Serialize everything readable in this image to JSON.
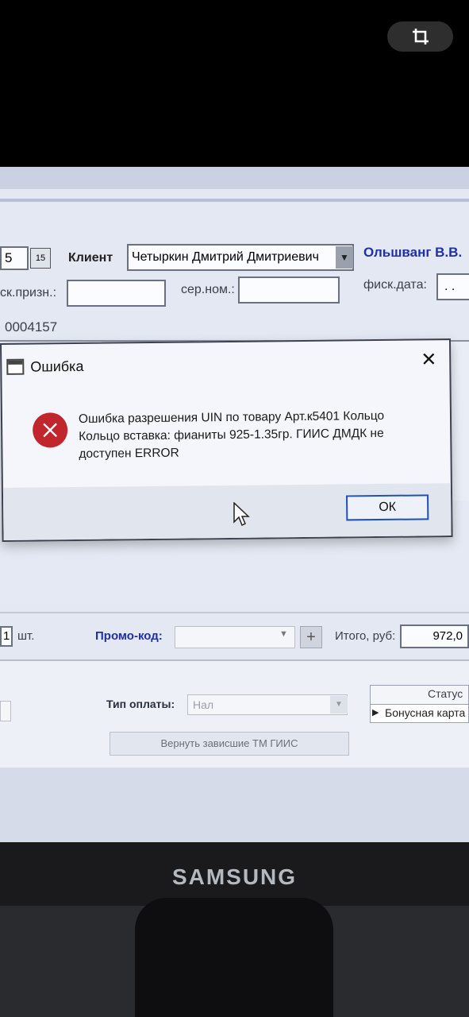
{
  "crop_button": {
    "icon": "crop-icon"
  },
  "form": {
    "date_fragment": "5",
    "calendar_label": "15",
    "client_label": "Клиент",
    "client_value": "Четыркин Дмитрий Дмитриевич",
    "manager_name": "Ольшванг В.В.",
    "fisc_sign_label": "ск.призн.:",
    "serial_label": "сер.ном.:",
    "fisc_date_label": "фиск.дата:",
    "fisc_date_value": ". .",
    "doc_number": "0004157"
  },
  "dialog": {
    "title": "Ошибка",
    "message": "Ошибка разрешения UIN по товару Арт.к5401 Кольцо Кольцо вставка: фианиты 925-1.35гр.   ГИИС ДМДК не доступен ERROR",
    "ok_label": "ОК"
  },
  "totals": {
    "qty": "1",
    "qty_unit": "шт.",
    "promo_label": "Промо-код:",
    "promo_value": "",
    "plus_label": "+",
    "total_label": "Итого, руб:",
    "total_value": "972,0"
  },
  "payment": {
    "type_label": "Тип оплаты:",
    "type_value": "Нал",
    "return_button": "Вернуть зависшие ТМ ГИИС",
    "status_header": "Статус",
    "status_row": "Бонусная карта"
  },
  "monitor": {
    "brand": "SAMSUNG"
  }
}
